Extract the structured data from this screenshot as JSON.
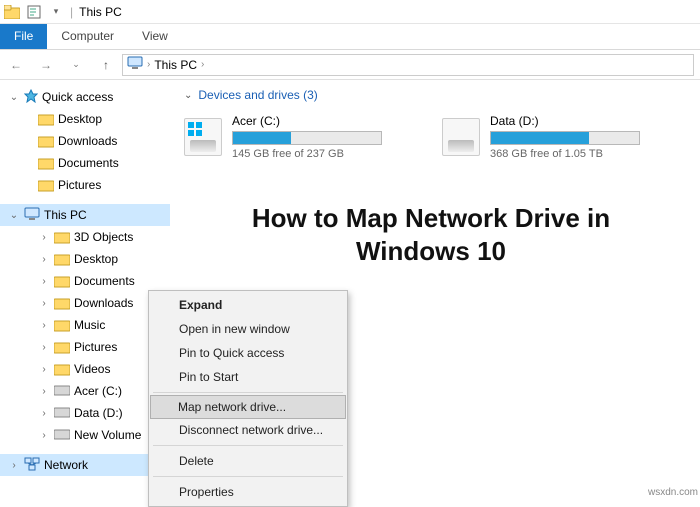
{
  "titlebar": {
    "title": "This PC",
    "separator": "|"
  },
  "ribbon": {
    "file": "File",
    "computer": "Computer",
    "view": "View"
  },
  "address": {
    "root_icon_name": "this-pc-icon",
    "crumb1": "This PC",
    "crumb_sep": "›"
  },
  "sidebar": {
    "quick_access": {
      "label": "Quick access",
      "expander": "⌄"
    },
    "qa_items": [
      {
        "label": "Desktop"
      },
      {
        "label": "Downloads"
      },
      {
        "label": "Documents"
      },
      {
        "label": "Pictures"
      }
    ],
    "this_pc": {
      "label": "This PC",
      "expander": "⌄"
    },
    "pc_items": [
      {
        "label": "3D Objects"
      },
      {
        "label": "Desktop"
      },
      {
        "label": "Documents"
      },
      {
        "label": "Downloads"
      },
      {
        "label": "Music"
      },
      {
        "label": "Pictures"
      },
      {
        "label": "Videos"
      },
      {
        "label": "Acer (C:)"
      },
      {
        "label": "Data (D:)"
      },
      {
        "label": "New Volume"
      }
    ],
    "network": {
      "label": "Network",
      "expander": "›"
    }
  },
  "content": {
    "group_header": "Devices and drives (3)",
    "drives": [
      {
        "name": "Acer (C:)",
        "free_text": "145 GB free of 237 GB",
        "fill_pct": 39,
        "show_flag": true
      },
      {
        "name": "Data (D:)",
        "free_text": "368 GB free of 1.05 TB",
        "fill_pct": 66,
        "show_flag": false
      }
    ]
  },
  "overlay": {
    "title": "How to Map Network Drive in Windows 10"
  },
  "context_menu": {
    "items": [
      {
        "label": "Expand",
        "bold": true
      },
      {
        "label": "Open in new window"
      },
      {
        "label": "Pin to Quick access"
      },
      {
        "label": "Pin to Start"
      },
      {
        "sep": true
      },
      {
        "label": "Map network drive...",
        "highlight": true
      },
      {
        "label": "Disconnect network drive..."
      },
      {
        "sep": true
      },
      {
        "label": "Delete"
      },
      {
        "sep": true
      },
      {
        "label": "Properties"
      }
    ]
  },
  "watermark": "wsxdn.com"
}
